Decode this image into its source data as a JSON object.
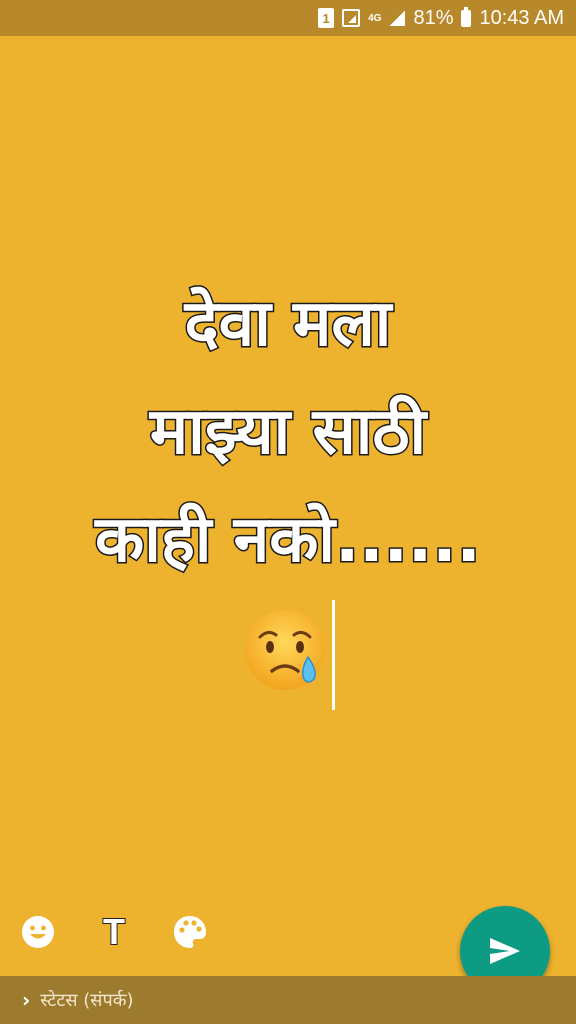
{
  "status_bar": {
    "sim_slot": "1",
    "network_type": "4G",
    "battery": "81%",
    "time": "10:43 AM"
  },
  "status_text": {
    "lines": [
      "देवा मला",
      "माझ्या साठी",
      "काही नको......"
    ],
    "emoji": "😢"
  },
  "toolbar": {
    "emoji_icon": "smiley-icon",
    "text_tool_label": "T",
    "palette_icon": "palette-icon"
  },
  "send_button": {
    "icon": "send-icon",
    "color": "#0E9B84"
  },
  "bottom_bar": {
    "audience_label": "स्टेटस (संपर्क)"
  },
  "colors": {
    "background": "#EDB32F",
    "status_bar": "#B8892A",
    "bottom_bar": "#9C7A2E"
  }
}
